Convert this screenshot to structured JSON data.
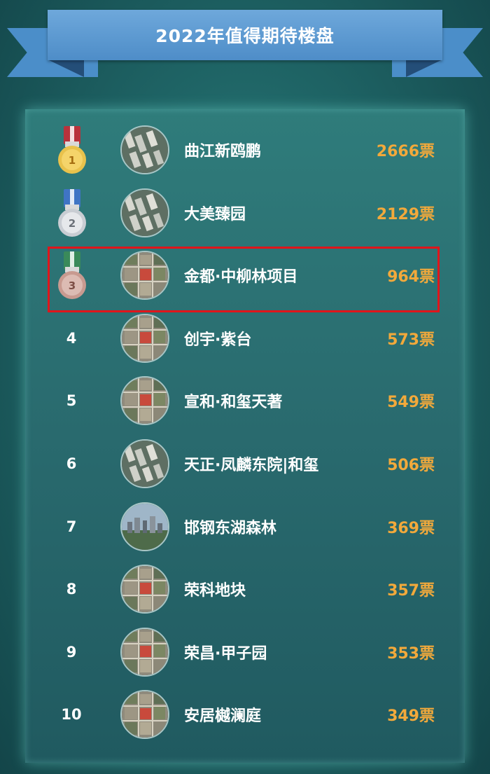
{
  "banner": {
    "title": "2022年值得期待楼盘"
  },
  "colors": {
    "accent_gold": "#f2a93b",
    "highlight_red": "#e0151b",
    "banner_blue": "#5a9ad3"
  },
  "rankings": [
    {
      "rank": "1",
      "medal": "gold",
      "name": "曲江新鸥鹏",
      "votes": "2666票",
      "thumb": "aerial-buildings"
    },
    {
      "rank": "2",
      "medal": "silver",
      "name": "大美臻园",
      "votes": "2129票",
      "thumb": "aerial-buildings"
    },
    {
      "rank": "3",
      "medal": "bronze",
      "name": "金都·中柳林项目",
      "votes": "964票",
      "thumb": "map-red-plot"
    },
    {
      "rank": "4",
      "medal": "",
      "name": "创宇·紫台",
      "votes": "573票",
      "thumb": "map-red-plot"
    },
    {
      "rank": "5",
      "medal": "",
      "name": "宣和·和玺天著",
      "votes": "549票",
      "thumb": "map-red-plot"
    },
    {
      "rank": "6",
      "medal": "",
      "name": "天正·凤麟东院|和玺",
      "votes": "506票",
      "thumb": "aerial-buildings"
    },
    {
      "rank": "7",
      "medal": "",
      "name": "邯钢东湖森林",
      "votes": "369票",
      "thumb": "skyline"
    },
    {
      "rank": "8",
      "medal": "",
      "name": "荣科地块",
      "votes": "357票",
      "thumb": "map-red-plot"
    },
    {
      "rank": "9",
      "medal": "",
      "name": "荣昌·甲子园",
      "votes": "353票",
      "thumb": "map-red-plot"
    },
    {
      "rank": "10",
      "medal": "",
      "name": "安居樾澜庭",
      "votes": "349票",
      "thumb": "map-red-plot"
    }
  ]
}
